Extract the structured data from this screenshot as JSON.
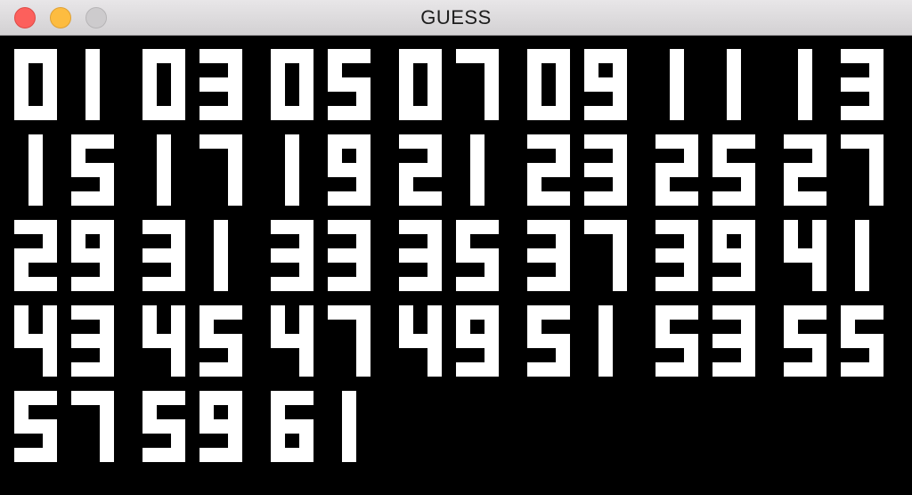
{
  "window": {
    "title": "GUESS",
    "controls": [
      "close",
      "minimize",
      "zoom"
    ]
  },
  "board": {
    "foreground": "#ffffff",
    "background": "#000000",
    "numbers": [
      "01",
      "03",
      "05",
      "07",
      "09",
      "11",
      "13",
      "15",
      "17",
      "19",
      "21",
      "23",
      "25",
      "27",
      "29",
      "31",
      "33",
      "35",
      "37",
      "39",
      "41",
      "43",
      "45",
      "47",
      "49",
      "51",
      "53",
      "55",
      "57",
      "59",
      "61"
    ]
  }
}
